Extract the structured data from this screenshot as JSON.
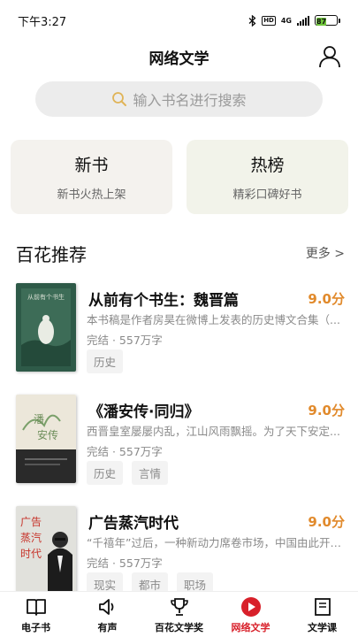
{
  "status_bar": {
    "time": "下午3:27",
    "network": "4G",
    "battery": "87"
  },
  "header": {
    "title": "网络文学"
  },
  "search": {
    "placeholder": "输入书名进行搜索"
  },
  "promos": [
    {
      "title": "新书",
      "subtitle": "新书火热上架"
    },
    {
      "title": "热榜",
      "subtitle": "精彩口碑好书"
    }
  ],
  "section": {
    "title": "百花推荐",
    "more": "更多 >"
  },
  "books": [
    {
      "title": "从前有个书生：魏晋篇",
      "score": "9.0分",
      "desc": "本书稿是作者房昊在微博上发表的历史博文合集（...",
      "meta": "完结 · 557万字",
      "tags": [
        "历史"
      ],
      "cover_colors": [
        "#2e5a48",
        "#c9d3c2"
      ]
    },
    {
      "title": "《潘安传·同归》",
      "score": "9.0分",
      "desc": "西晋皇室屡屡内乱，江山风雨飘摇。为了天下安定...",
      "meta": "完结 · 557万字",
      "tags": [
        "历史",
        "言情"
      ],
      "cover_colors": [
        "#ece7da",
        "#2a2a2a"
      ]
    },
    {
      "title": "广告蒸汽时代",
      "score": "9.0分",
      "desc": "“千禧年”过后，一种新动力席卷市场，中国由此开启...",
      "meta": "完结 · 557万字",
      "tags": [
        "现实",
        "都市",
        "职场"
      ],
      "cover_colors": [
        "#e1e1dc",
        "#c7342b"
      ]
    }
  ],
  "tabs": [
    {
      "label": "电子书",
      "icon": "book-open-icon",
      "active": false
    },
    {
      "label": "有声",
      "icon": "speaker-icon",
      "active": false
    },
    {
      "label": "百花文学奖",
      "icon": "trophy-icon",
      "active": false
    },
    {
      "label": "网络文学",
      "icon": "play-circle-icon",
      "active": true
    },
    {
      "label": "文学课",
      "icon": "notebook-icon",
      "active": false
    }
  ],
  "colors": {
    "accent": "#d8202a",
    "score": "#e18a2c"
  }
}
